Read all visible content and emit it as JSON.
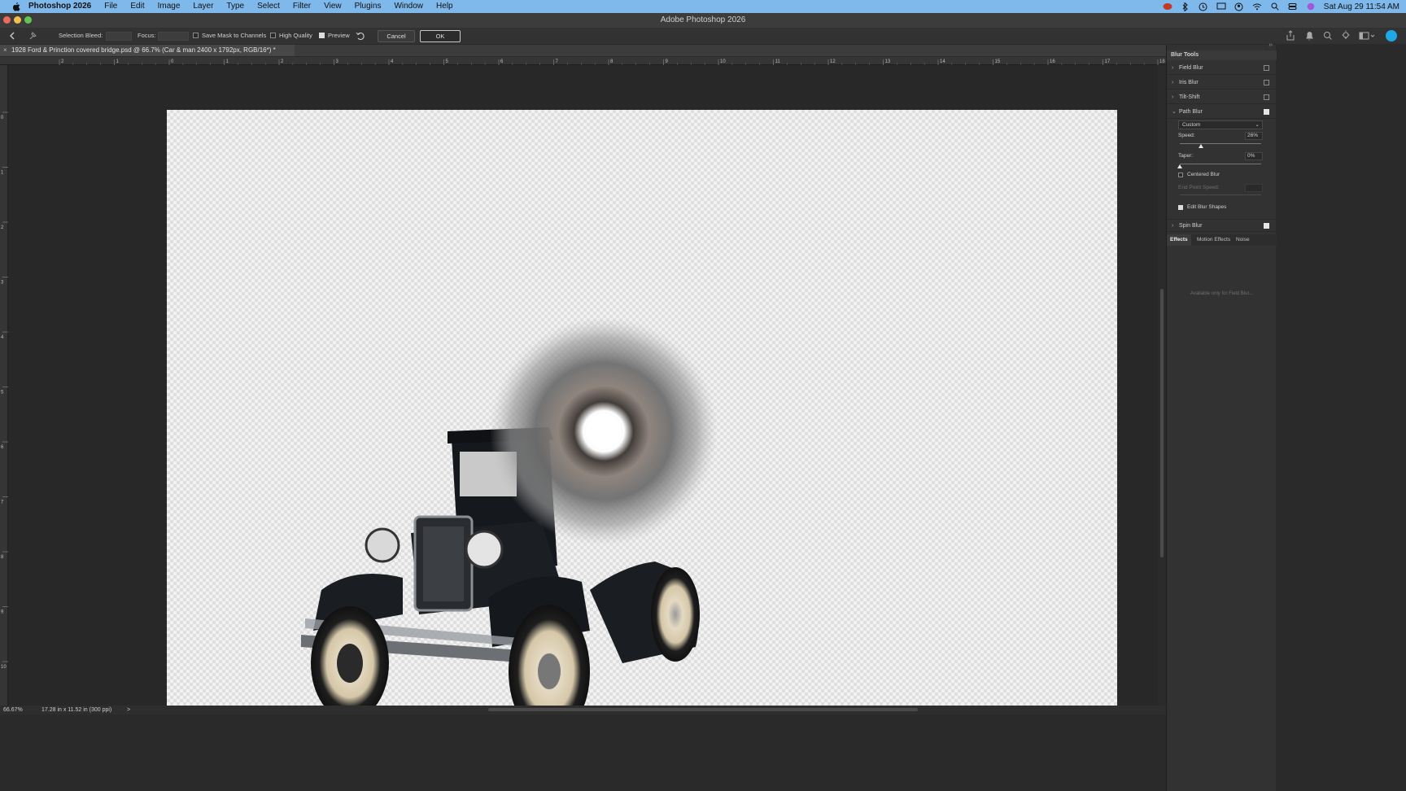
{
  "menubar": {
    "app": "Photoshop 2026",
    "items": [
      "File",
      "Edit",
      "Image",
      "Layer",
      "Type",
      "Select",
      "Filter",
      "View",
      "Plugins",
      "Window",
      "Help"
    ],
    "clock": "Sat Aug 29  11:54 AM"
  },
  "window": {
    "title": "Adobe Photoshop 2026"
  },
  "options": {
    "selection_bleed_label": "Selection Bleed:",
    "focus_label": "Focus:",
    "save_mask_label": "Save Mask to Channels",
    "high_quality_label": "High Quality",
    "preview_label": "Preview",
    "cancel_label": "Cancel",
    "ok_label": "OK"
  },
  "document": {
    "tab_title": "1928 Ford & Prinction covered bridge.psd @ 66.7% (Car & man 2400 x 1792px, RGB/16*) *"
  },
  "rulers": {
    "horizontal": [
      "2",
      "1",
      "0",
      "1",
      "2",
      "3",
      "4",
      "5",
      "6",
      "7",
      "8",
      "9",
      "10",
      "11",
      "12",
      "13",
      "14",
      "15",
      "16",
      "17",
      "18",
      "19",
      "20"
    ],
    "vertical": [
      "0",
      "1",
      "2",
      "3",
      "4",
      "5",
      "6",
      "7",
      "8",
      "9",
      "10",
      "11"
    ]
  },
  "status": {
    "zoom": "66.67%",
    "doc_info": "17.28 in x 11.52 in (300 ppi)",
    "arrow": ">"
  },
  "panel": {
    "title": "Blur Tools",
    "tools": [
      {
        "label": "Field Blur",
        "checked": false,
        "expanded": false
      },
      {
        "label": "Iris Blur",
        "checked": false,
        "expanded": false
      },
      {
        "label": "Tilt-Shift",
        "checked": false,
        "expanded": false
      },
      {
        "label": "Path Blur",
        "checked": true,
        "expanded": true
      },
      {
        "label": "Spin Blur",
        "checked": true,
        "expanded": false
      }
    ],
    "path_blur": {
      "preset": "Custom",
      "speed_label": "Speed:",
      "speed_value": "26%",
      "speed": 0.26,
      "taper_label": "Taper:",
      "taper_value": "0%",
      "taper": 0,
      "centered_blur_label": "Centered Blur",
      "end_point_speed_label": "End Point Speed:",
      "edit_blur_shapes_label": "Edit Blur Shapes"
    },
    "tabs": [
      "Effects",
      "Motion Effects",
      "Noise"
    ],
    "active_tab": "Effects",
    "effects_note": "Available only for Field Blur..."
  }
}
